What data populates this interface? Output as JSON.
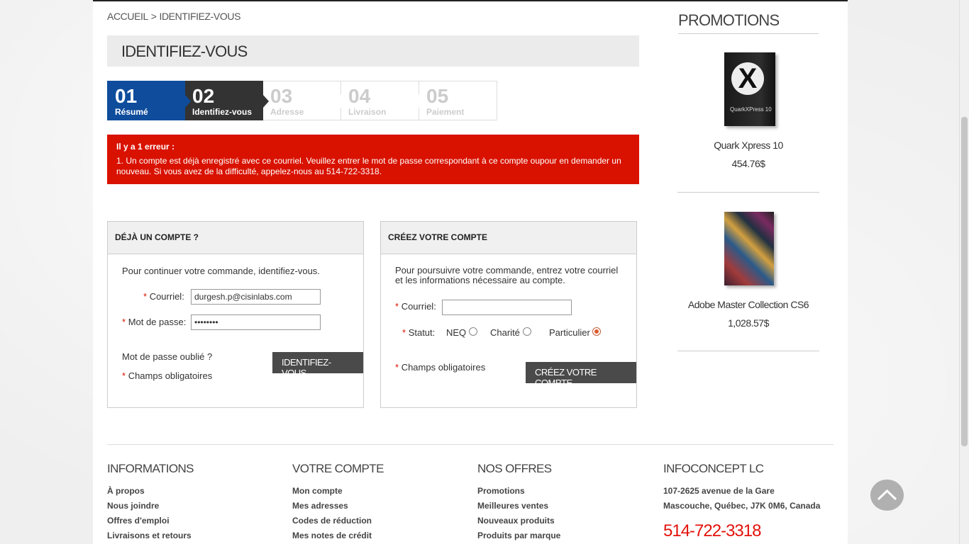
{
  "breadcrumb": {
    "home": "ACCUEIL",
    "separator": ">",
    "current": "IDENTIFIEZ-VOUS"
  },
  "page_title": "IDENTIFIEZ-VOUS",
  "steps": [
    {
      "num": "01",
      "label": "Résumé",
      "state": "done"
    },
    {
      "num": "02",
      "label": "Identifiez-vous",
      "state": "active"
    },
    {
      "num": "03",
      "label": "Adresse",
      "state": "todo"
    },
    {
      "num": "04",
      "label": "Livraison",
      "state": "todo"
    },
    {
      "num": "05",
      "label": "Paiement",
      "state": "todo"
    }
  ],
  "error": {
    "title": "Il y a 1 erreur :",
    "message": "1.  Un compte est déjà enregistré avec ce courriel. Veuillez entrer le mot de passe correspondant à ce compte oupour en demander un nouveau. Si vous avez de la difficulté, appelez-nous au 514-722-3318."
  },
  "login": {
    "heading": "DÉJÀ UN COMPTE ?",
    "intro": "Pour continuer votre commande, identifiez-vous.",
    "email_label": "Courriel:",
    "email_value": "durgesh.p@cisinlabs.com",
    "password_label": "Mot de passe:",
    "password_value": "••••••••",
    "forgot": "Mot de passe oublié ?",
    "required": "Champs obligatoires",
    "submit": "IDENTIFIEZ-VOUS"
  },
  "register": {
    "heading": "CRÉEZ VOTRE COMPTE",
    "intro_line1": "Pour poursuivre votre commande, entrez votre courriel",
    "intro_line2": "et les informations nécessaire au compte.",
    "email_label": "Courriel:",
    "email_value": "",
    "status_label": "Statut:",
    "status_options": [
      "NEQ",
      "Charité",
      "Particulier"
    ],
    "status_selected": "Particulier",
    "required": "Champs obligatoires",
    "submit": "CRÉEZ VOTRE COMPTE"
  },
  "sidebar": {
    "heading": "PROMOTIONS",
    "items": [
      {
        "name": "Quark Xpress 10",
        "price": "454.76$",
        "icon": "quark-box-image"
      },
      {
        "name": "Adobe Master Collection CS6",
        "price": "1,028.57$",
        "icon": "adobe-box-image"
      }
    ]
  },
  "footer": {
    "informations": {
      "heading": "INFORMATIONS",
      "links": [
        "À propos",
        "Nous joindre",
        "Offres d'emploi",
        "Livraisons et retours"
      ]
    },
    "account": {
      "heading": "VOTRE COMPTE",
      "links": [
        "Mon compte",
        "Mes adresses",
        "Codes de réduction",
        "Mes notes de crédit"
      ]
    },
    "offers": {
      "heading": "NOS OFFRES",
      "links": [
        "Promotions",
        "Meilleures ventes",
        "Nouveaux produits",
        "Produits par marque"
      ]
    },
    "company": {
      "heading": "INFOCONCEPT LC",
      "address1": "107-2625 avenue de la Gare",
      "address2": "Mascouche, Québec, J7K 0M6, Canada",
      "phone": "514-722-3318"
    }
  },
  "colors": {
    "accent_blue": "#0f4c9c",
    "error_red": "#d91200",
    "phone_red": "#e3120b",
    "dark_button": "#4a4a4a"
  }
}
